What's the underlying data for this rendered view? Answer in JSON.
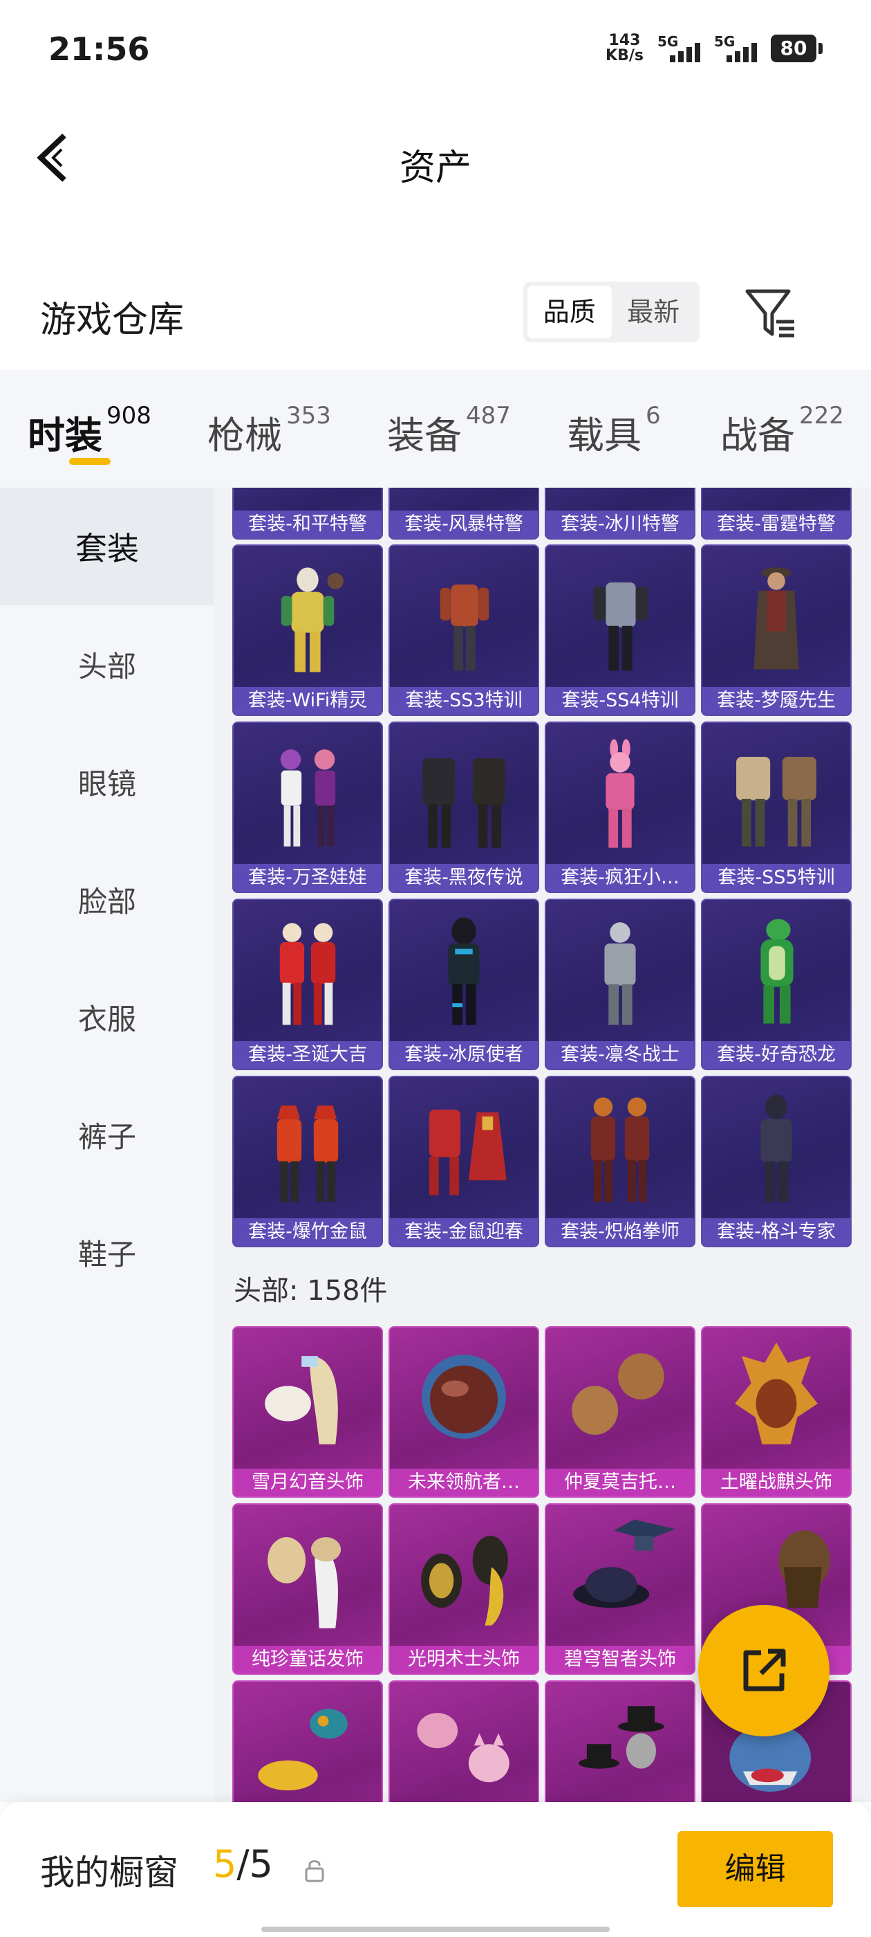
{
  "status_bar": {
    "time": "21:56",
    "net_speed_value": "143",
    "net_speed_unit": "KB/s",
    "sim1_label": "5G",
    "sim2_label": "5G",
    "battery": "80"
  },
  "nav": {
    "title": "资产"
  },
  "warehouse": {
    "title": "游戏仓库",
    "sort_options": [
      "品质",
      "最新"
    ],
    "active_sort": "品质"
  },
  "tabs": [
    {
      "label": "时装",
      "count": "908"
    },
    {
      "label": "枪械",
      "count": "353"
    },
    {
      "label": "装备",
      "count": "487"
    },
    {
      "label": "载具",
      "count": "6"
    },
    {
      "label": "战备",
      "count": "222"
    }
  ],
  "sidebar": {
    "items": [
      "套装",
      "头部",
      "眼镜",
      "脸部",
      "衣服",
      "裤子",
      "鞋子"
    ]
  },
  "suits": {
    "row0": [
      "套装-和平特警",
      "套装-风暴特警",
      "套装-冰川特警",
      "套装-雷霆特警"
    ],
    "row1": [
      "套装-WiFi精灵",
      "套装-SS3特训",
      "套装-SS4特训",
      "套装-梦魇先生"
    ],
    "row2": [
      "套装-万圣娃娃",
      "套装-黑夜传说",
      "套装-疯狂小…",
      "套装-SS5特训"
    ],
    "row3": [
      "套装-圣诞大吉",
      "套装-冰原使者",
      "套装-凛冬战士",
      "套装-好奇恐龙"
    ],
    "row4": [
      "套装-爆竹金鼠",
      "套装-金鼠迎春",
      "套装-炽焰拳师",
      "套装-格斗专家"
    ]
  },
  "head_section": {
    "title": "头部: 158件"
  },
  "heads": {
    "row0": [
      "雪月幻音头饰",
      "未来领航者…",
      "仲夏莫吉托…",
      "土曜战麒头饰"
    ],
    "row1": [
      "纯珍童话发饰",
      "光明术士头饰",
      "碧穹智者头饰",
      "…饰"
    ]
  },
  "bottom": {
    "showcase_label": "我的橱窗",
    "showcase_current": "5",
    "showcase_total": "/5",
    "edit_label": "编辑"
  },
  "colors": {
    "accent": "#f7b400",
    "suit_card": "#2c2266",
    "head_card": "#8a2484"
  }
}
